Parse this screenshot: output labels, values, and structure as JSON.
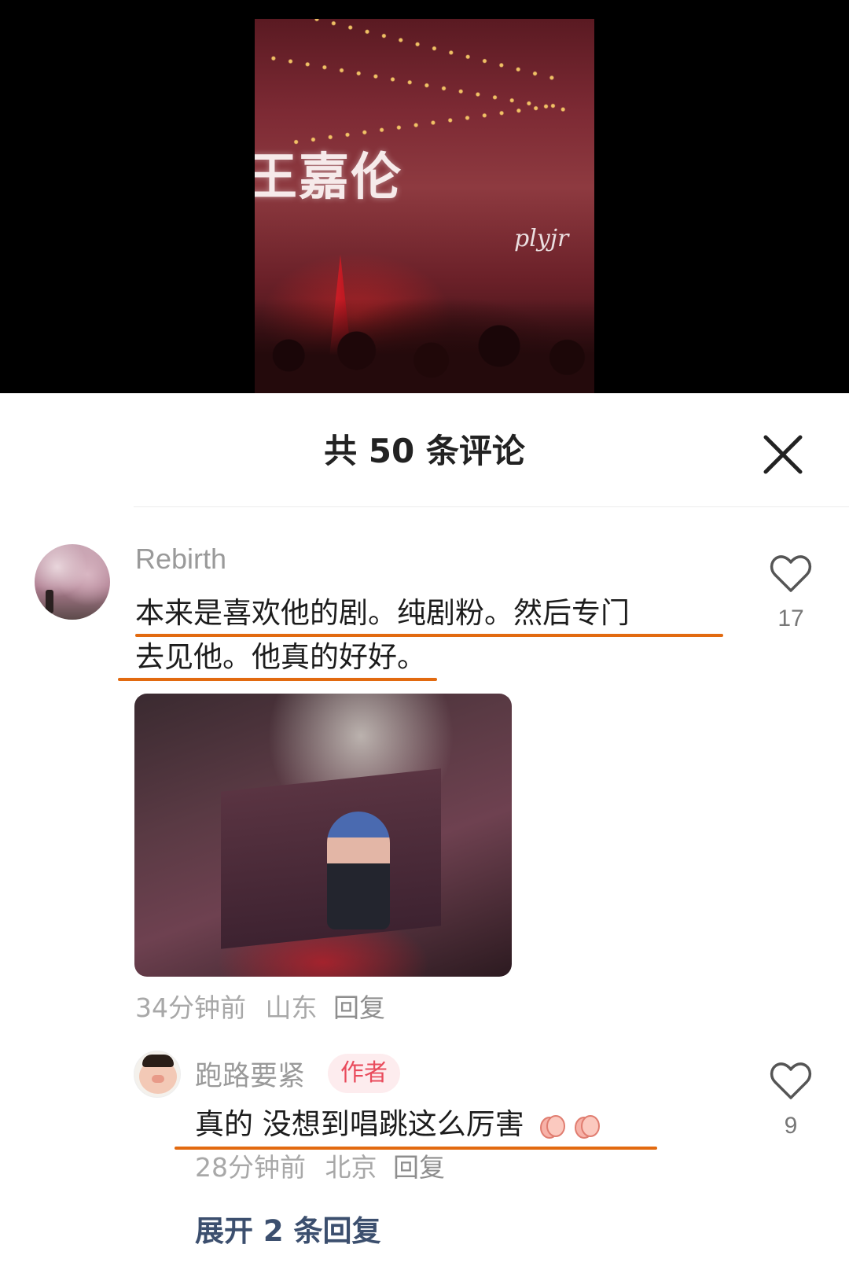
{
  "video": {
    "caption": "王嘉伦",
    "watermark": "plyjr"
  },
  "panel": {
    "title": "共 50 条评论"
  },
  "comments": [
    {
      "username": "Rebirth",
      "text_line1": "本来是喜欢他的剧。纯剧粉。然后专门",
      "text_line2": "去见他。他真的好好。",
      "time": "34分钟前",
      "location": "山东",
      "reply_label": "回复",
      "likes": "17",
      "replies": [
        {
          "username": "跑路要紧",
          "badge": "作者",
          "text": "真的 没想到唱跳这么厉害",
          "time": "28分钟前",
          "location": "北京",
          "reply_label": "回复",
          "likes": "9"
        }
      ],
      "expand_label": "展开 2 条回复"
    }
  ],
  "colors": {
    "underline": "#e26a10",
    "badge_text": "#e94b5c",
    "badge_bg": "#fdecee",
    "expand_link": "#3c4f6e"
  },
  "icons": [
    "close-icon",
    "heart-icon",
    "clapping-hands-emoji"
  ]
}
